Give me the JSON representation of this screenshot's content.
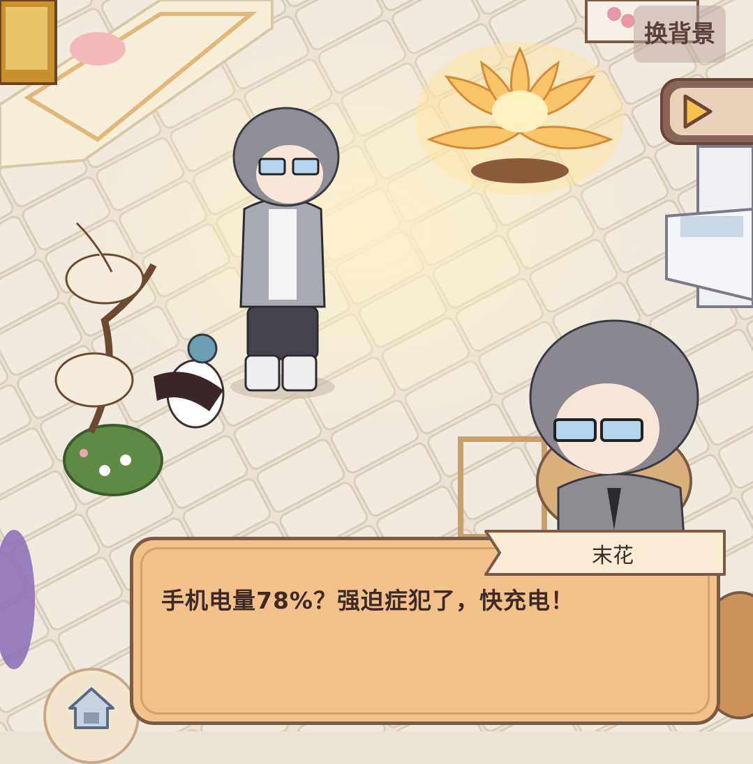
{
  "top_right": {
    "change_background_label": "换背景"
  },
  "dialog": {
    "speaker": "末花",
    "text": "手机电量78%？强迫症犯了，快充电！"
  },
  "icons": {
    "play": "play-icon",
    "home": "home-icon"
  },
  "colors": {
    "dialog_fill": "#f2c28a",
    "dialog_border": "#7b5a44",
    "name_tag_fill": "#fbecd6",
    "text": "#3e2a24"
  }
}
